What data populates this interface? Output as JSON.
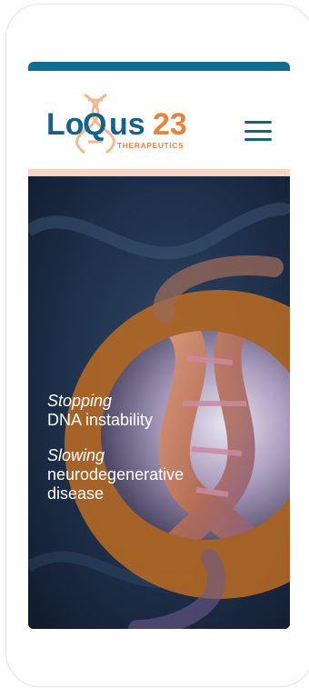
{
  "logo": {
    "prefix": "Lo",
    "q": "Q",
    "suffix": "us",
    "number": "23",
    "tagline": "THERAPEUTICS",
    "blue": "#14638a",
    "orange": "#e8843a"
  },
  "header": {
    "menu_icon": "hamburger-menu-icon"
  },
  "hero": {
    "line1_italic": "Stopping",
    "line1_rest": "DNA instability",
    "line2_italic": "Slowing",
    "line2_rest_a": "neurodegenerative",
    "line2_rest_b": "disease",
    "image": "dna-helix-illustration"
  },
  "colors": {
    "accent_bar": "#0d6e8f",
    "header_rule": "#f6d6c2",
    "ring": "#c46f24",
    "hero_bg": "#1a2940"
  }
}
